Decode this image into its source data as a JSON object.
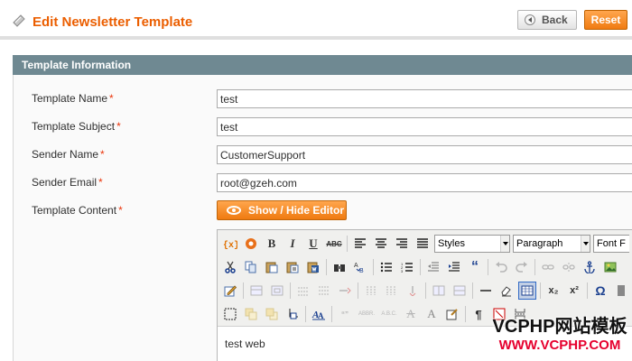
{
  "header": {
    "title": "Edit Newsletter Template",
    "back_label": "Back",
    "reset_label": "Reset"
  },
  "section": {
    "title": "Template Information"
  },
  "fields": [
    {
      "label": "Template Name",
      "value": "test"
    },
    {
      "label": "Template Subject",
      "value": "test"
    },
    {
      "label": "Sender Name",
      "value": "CustomerSupport"
    },
    {
      "label": "Sender Email",
      "value": "root@gzeh.com"
    }
  ],
  "content": {
    "label": "Template Content",
    "toggle_editor_label": "Show / Hide Editor",
    "editor_text": "test web"
  },
  "required_marker": "*",
  "toolbar": {
    "styles_select": "Styles",
    "format_select": "Paragraph",
    "font_select": "Font F",
    "bold": "B",
    "italic": "I",
    "underline": "U",
    "strike": "ABC",
    "quote": "“",
    "subscript": "x₂",
    "superscript": "x²",
    "omega": "Ω",
    "pilcrow": "¶",
    "font_color": "A",
    "abbr": "ABBR.",
    "acronym": "A.B.C.",
    "cite": "“”"
  },
  "watermark": {
    "top": "VCPHP网站模板",
    "bottom": "WWW.VCPHP.COM"
  },
  "colors": {
    "accent": "#eb5e00",
    "section_header": "#6f8992",
    "required": "#eb340a",
    "button_orange": "#f07b12"
  }
}
